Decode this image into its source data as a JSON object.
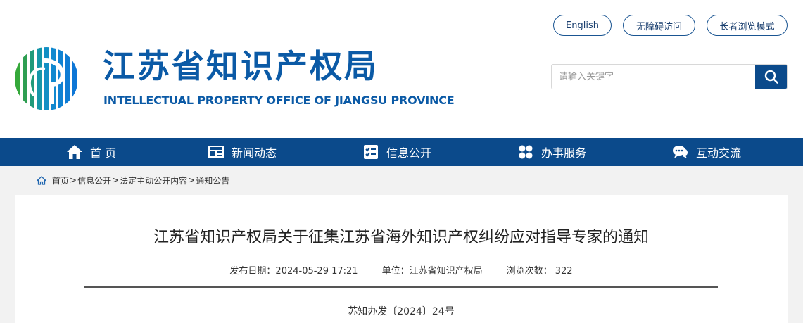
{
  "header": {
    "title": "江苏省知识产权局",
    "subtitle": "INTELLECTUAL PROPERTY OFFICE OF JIANGSU PROVINCE",
    "brand_color": "#0b5aa6"
  },
  "top_links": {
    "english": "English",
    "accessibility": "无障碍访问",
    "elder_mode": "长者浏览模式"
  },
  "search": {
    "placeholder": "请输入关键字",
    "icon": "search-icon"
  },
  "nav": {
    "bg_color": "#0b4a8b",
    "items": [
      {
        "label": "首 页",
        "icon": "home-icon"
      },
      {
        "label": "新闻动态",
        "icon": "news-icon"
      },
      {
        "label": "信息公开",
        "icon": "info-icon"
      },
      {
        "label": "办事服务",
        "icon": "service-icon"
      },
      {
        "label": "互动交流",
        "icon": "chat-icon"
      }
    ]
  },
  "breadcrumb": {
    "items": [
      "首页",
      "信息公开",
      "法定主动公开内容",
      "通知公告"
    ],
    "separator": ">"
  },
  "article": {
    "title": "江苏省知识产权局关于征集江苏省海外知识产权纠纷应对指导专家的通知",
    "date_label": "发布日期：",
    "date": "2024-05-29 17:21",
    "unit_label": "单位：",
    "unit": "江苏省知识产权局",
    "views_label": "浏览次数：",
    "views": "322",
    "doc_number": "苏知办发〔2024〕24号"
  }
}
